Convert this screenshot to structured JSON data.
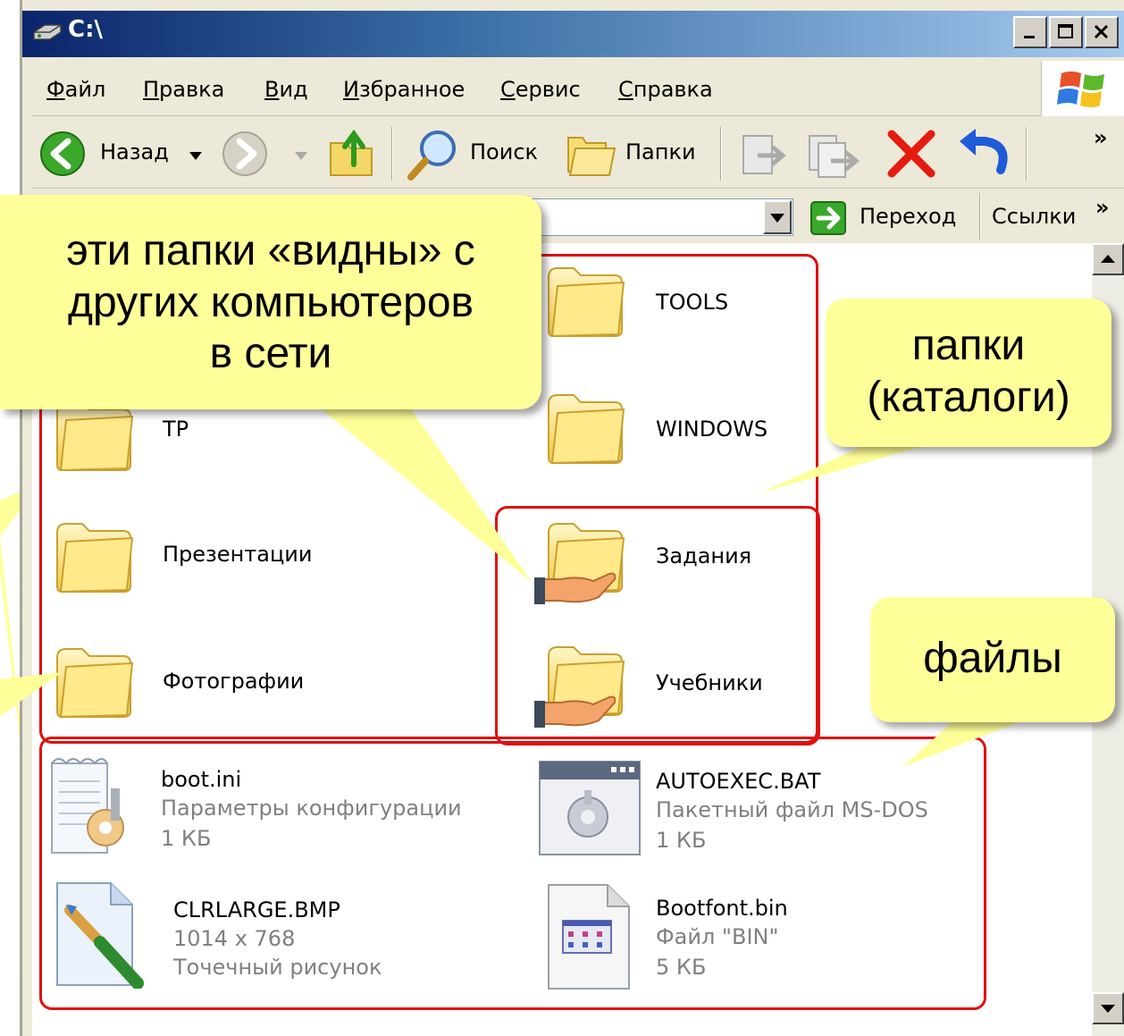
{
  "window": {
    "title": "C:\\"
  },
  "menu": {
    "file": {
      "first": "Ф",
      "rest": "айл"
    },
    "edit": {
      "first": "П",
      "rest": "равка"
    },
    "view": {
      "first": "В",
      "rest": "ид"
    },
    "favorites": {
      "first": "И",
      "rest": "збранное"
    },
    "tools": {
      "first": "С",
      "rest": "ервис"
    },
    "help": {
      "first": "С",
      "rest": "правка"
    }
  },
  "toolbar": {
    "back_label": "Назад",
    "search_label": "Поиск",
    "folders_label": "Папки",
    "more": "»"
  },
  "addressbar": {
    "go_label": "Переход",
    "links_label": "Ссылки",
    "more": "»"
  },
  "folders": [
    {
      "name": "TOOLS"
    },
    {
      "name": "TP"
    },
    {
      "name": "WINDOWS"
    },
    {
      "name": "Презентации"
    },
    {
      "name": "Задания"
    },
    {
      "name": "Фотографии"
    },
    {
      "name": "Учебники"
    }
  ],
  "files": [
    {
      "name": "boot.ini",
      "type": "Параметры конфигурации",
      "size": "1 КБ"
    },
    {
      "name": "AUTOEXEC.BAT",
      "type": "Пакетный файл MS-DOS",
      "size": "1 КБ"
    },
    {
      "name": "CLRLARGE.BMP",
      "dims": "1014 x 768",
      "type": "Точечный рисунок"
    },
    {
      "name": "Bootfont.bin",
      "type": "Файл \"BIN\"",
      "size": "5 КБ"
    }
  ],
  "callouts": {
    "shared": {
      "line1": "эти папки «видны» с",
      "line2": "других компьютеров",
      "line3": "в сети"
    },
    "folders": {
      "line1": "папки",
      "line2": "(каталоги)"
    },
    "files": {
      "line1": "файлы"
    }
  },
  "colors": {
    "highlight_red": "#e01010",
    "callout_yellow": "#ffff99",
    "titlebar_blue": "#0a246a"
  }
}
